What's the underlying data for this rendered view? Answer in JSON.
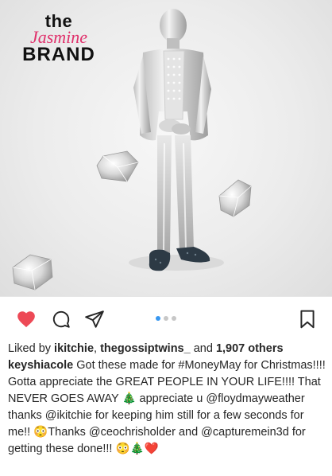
{
  "watermark": {
    "line1": "the",
    "line2": "Jasmine",
    "line3": "BRAND"
  },
  "post": {
    "carousel": {
      "count": 3,
      "active_index": 0
    },
    "liked": true,
    "likes": {
      "prefix": "Liked by ",
      "user1": "ikitchie",
      "sep": ", ",
      "user2": "thegossiptwins_",
      "and": " and ",
      "others": "1,907 others"
    },
    "caption": {
      "username": "keyshiacole",
      "seg1": " Got these made for ",
      "hashtag": "#MoneyMay",
      "seg2": " for Christmas!!!! Gotta appreciate the GREAT PEOPLE IN YOUR LIFE!!!! That NEVER GOES AWAY ",
      "emoji_tree1": "🎄",
      "seg3": " appreciate u ",
      "mention1": "@floydmayweather",
      "seg4": " thanks ",
      "mention2": "@ikitchie",
      "seg5": " for keeping him still for a few seconds for me!! ",
      "emoji_smile1": "😳",
      "seg6": "Thanks ",
      "mention3": "@ceochrisholder",
      "seg7": " and ",
      "mention4": "@capturemein3d",
      "seg8": " for getting these done!!! ",
      "emoji_smile2": "😳",
      "emoji_tree2": "🎄",
      "emoji_heart": "❤️"
    }
  },
  "colors": {
    "heart": "#ed4956",
    "dot_active": "#3897f0",
    "dot_inactive": "#c7c7c7",
    "logo_accent": "#e0306b"
  },
  "icons": [
    "heart-icon",
    "comment-icon",
    "share-icon",
    "bookmark-icon"
  ]
}
